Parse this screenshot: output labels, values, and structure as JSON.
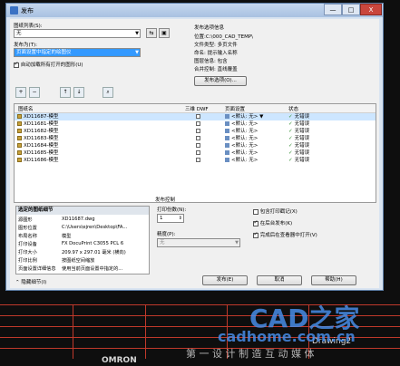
{
  "dialog": {
    "title": "发布",
    "window_buttons": [
      "—",
      "□",
      "X"
    ]
  },
  "sheet_list": {
    "label": "图纸列表(S):",
    "value": "无"
  },
  "publish_to": {
    "label": "发布为(T):",
    "value": "页面设置中指定的绘图仪"
  },
  "auto_load_checkbox": {
    "label": "自动加载所有打开的图形(U)",
    "checked": true
  },
  "publish_options": {
    "heading": "发布选项信息",
    "rows": [
      "位置:C:\\000_CAD_TEMP\\",
      "文件类型: 多页文件",
      "命名: 提示输入名称",
      "图层信息: 包含",
      "合并控制: 直线覆盖"
    ],
    "button_label": "发布选项(O)..."
  },
  "toolbar_icons": [
    "add-sheets-icon",
    "remove-sheets-icon",
    "move-up-icon",
    "move-down-icon",
    "preview-icon"
  ],
  "table": {
    "headers": [
      "图纸名",
      "三维 DWF",
      "页面设置",
      "状态"
    ],
    "rows": [
      {
        "name": "XD11687-模型",
        "page_setup": "<默认: 无>",
        "status": "无错误",
        "selected": true
      },
      {
        "name": "XD11681-模型",
        "page_setup": "<默认: 无>",
        "status": "无错误",
        "selected": false
      },
      {
        "name": "XD11682-模型",
        "page_setup": "<默认: 无>",
        "status": "无错误",
        "selected": false
      },
      {
        "name": "XD11683-模型",
        "page_setup": "<默认: 无>",
        "status": "无错误",
        "selected": false
      },
      {
        "name": "XD11684-模型",
        "page_setup": "<默认: 无>",
        "status": "无错误",
        "selected": false
      },
      {
        "name": "XD11685-模型",
        "page_setup": "<默认: 无>",
        "status": "无错误",
        "selected": false
      },
      {
        "name": "XD11686-模型",
        "page_setup": "<默认: 无>",
        "status": "无错误",
        "selected": false
      }
    ]
  },
  "details": {
    "heading": "选定的图纸细节",
    "rows": [
      {
        "k": "源图形",
        "v": "XD11687.dwg"
      },
      {
        "k": "图形位置",
        "v": "C:\\Users\\ejren\\Desktop\\FA..."
      },
      {
        "k": "布局名称",
        "v": "模型"
      },
      {
        "k": "打印设备",
        "v": "FX DocuPrint C3055 PCL 6"
      },
      {
        "k": "打印大小",
        "v": "209.97 x 297.01 毫米 (横向)"
      },
      {
        "k": "打印比例",
        "v": "按图纸空间缩放"
      },
      {
        "k": "页面设置详细信息",
        "v": "使用当前页面设置中指定的..."
      }
    ],
    "hide_details": "隐藏细节(I)"
  },
  "publish_control": {
    "heading": "发布控制",
    "copies_label": "打印份数(N):",
    "copies": "1",
    "precision_label": "精度(P):",
    "precision": "无",
    "include_stamp": {
      "label": "包含打印戳记(X)",
      "checked": false
    },
    "publish_background": {
      "label": "在后台发布(K)",
      "checked": true
    },
    "open_viewer": {
      "label": "完成后在查看器中打开(V)",
      "checked": true
    }
  },
  "buttons": {
    "publish": "发布(E)",
    "cancel": "取消",
    "help": "帮助(H)"
  },
  "background": {
    "text": "Drawing2",
    "logo": "OMRON",
    "watermark": "CAD之家",
    "watermark_url": "cadhome.com.cn",
    "watermark_tag": "第 一 设 计 制 造 互 动 媒 体"
  }
}
